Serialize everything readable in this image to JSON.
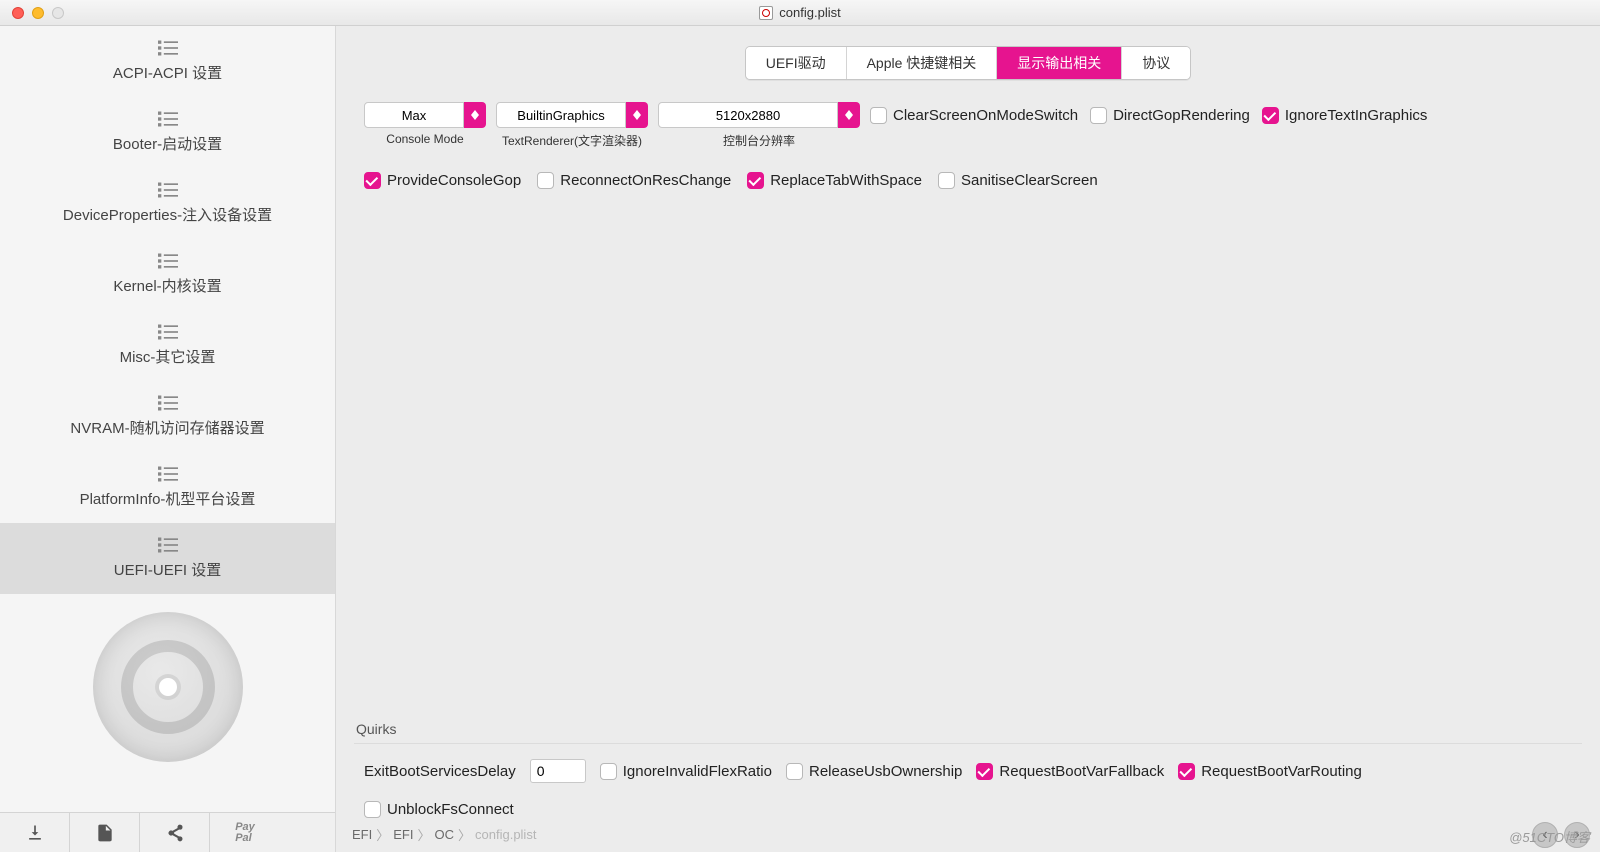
{
  "window": {
    "title": "config.plist"
  },
  "sidebar": {
    "items": [
      {
        "label": "ACPI-ACPI 设置"
      },
      {
        "label": "Booter-启动设置"
      },
      {
        "label": "DeviceProperties-注入设备设置"
      },
      {
        "label": "Kernel-内核设置"
      },
      {
        "label": "Misc-其它设置"
      },
      {
        "label": "NVRAM-随机访问存储器设置"
      },
      {
        "label": "PlatformInfo-机型平台设置"
      },
      {
        "label": "UEFI-UEFI 设置"
      }
    ],
    "activeIndex": 7
  },
  "tabs": {
    "items": [
      "UEFI驱动",
      "Apple 快捷键相关",
      "显示输出相关",
      "协议"
    ],
    "activeIndex": 2
  },
  "output": {
    "consoleMode": {
      "value": "Max",
      "label": "Console Mode"
    },
    "textRenderer": {
      "value": "BuiltinGraphics",
      "label": "TextRenderer(文字渲染器)"
    },
    "resolution": {
      "value": "5120x2880",
      "label": "控制台分辨率"
    },
    "checks": [
      {
        "label": "ClearScreenOnModeSwitch",
        "checked": false
      },
      {
        "label": "DirectGopRendering",
        "checked": false
      },
      {
        "label": "IgnoreTextInGraphics",
        "checked": true
      },
      {
        "label": "ProvideConsoleGop",
        "checked": true
      },
      {
        "label": "ReconnectOnResChange",
        "checked": false
      },
      {
        "label": "ReplaceTabWithSpace",
        "checked": true
      },
      {
        "label": "SanitiseClearScreen",
        "checked": false
      }
    ]
  },
  "quirks": {
    "title": "Quirks",
    "exitDelay": {
      "label": "ExitBootServicesDelay",
      "value": "0"
    },
    "checks": [
      {
        "label": "IgnoreInvalidFlexRatio",
        "checked": false
      },
      {
        "label": "ReleaseUsbOwnership",
        "checked": false
      },
      {
        "label": "RequestBootVarFallback",
        "checked": true
      },
      {
        "label": "RequestBootVarRouting",
        "checked": true
      },
      {
        "label": "UnblockFsConnect",
        "checked": false
      }
    ]
  },
  "breadcrumb": [
    "EFI",
    "EFI",
    "OC",
    "config.plist"
  ],
  "watermark": "@51CTO博客"
}
